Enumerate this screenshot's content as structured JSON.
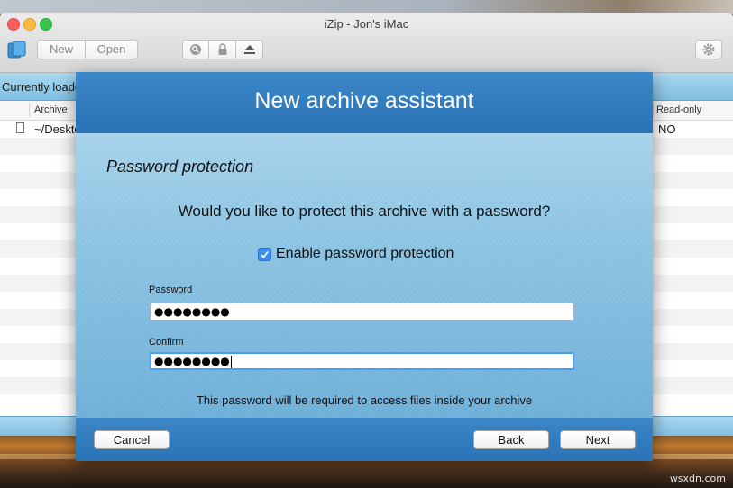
{
  "window": {
    "title": "iZip - Jon's iMac"
  },
  "toolbar": {
    "new_label": "New",
    "open_label": "Open",
    "icons": [
      "app-icon",
      "search-icon",
      "lock-icon",
      "eject-icon",
      "gear-icon"
    ]
  },
  "main": {
    "status_text": "Currently loaded",
    "columns": {
      "archive": "Archive",
      "readonly": "Read-only"
    },
    "rows": [
      {
        "archive": "~/Desktop",
        "readonly": "NO"
      }
    ]
  },
  "dialog": {
    "title": "New archive assistant",
    "section_title": "Password protection",
    "question": "Would you like to protect this archive with a password?",
    "checkbox_label": "Enable password protection",
    "checkbox_checked": true,
    "password_label": "Password",
    "password_value": "●●●●●●●●",
    "confirm_label": "Confirm",
    "confirm_value": "●●●●●●●●",
    "hint": "This password will be required to access files inside your archive",
    "cancel_label": "Cancel",
    "back_label": "Back",
    "next_label": "Next"
  },
  "watermark": "wsxdn.com",
  "colors": {
    "dialog_header": "#2a73b6",
    "dialog_body": "#8cc3e2",
    "status_bar": "#a9d7f0",
    "checkbox": "#3b8ff0"
  }
}
